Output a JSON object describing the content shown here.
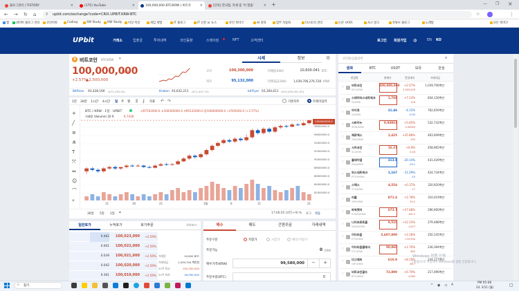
{
  "browser": {
    "tabs": [
      {
        "label": "블로그관리 | TISTORY",
        "color": "#ea4335"
      },
      {
        "label": "(175) YouTube",
        "color": "#ff0000"
      },
      {
        "label": "100,000,000 BTC/KRW | 비트코",
        "color": "#093687"
      },
      {
        "label": "[단독] 한국형, 유세 중 '이 말을'",
        "color": "#ea4335"
      }
    ],
    "url": "upbit.com/exchange?code=CRIX.UPBIT.KRW-BTC",
    "bookmarks": [
      "앱",
      "네이버 블로그 관리",
      "코인이야",
      "Coding",
      "SW Study",
      "HW Study",
      "이것 저것",
      "게임 개발",
      "IT 블로그",
      "IT 신문 or 뉴스",
      "유민 북마크",
      "AI 강좌",
      "업무 자동화",
      "티스토리 관리",
      "논문 사이트",
      "사고 알고",
      "유튜브 블로그",
      "노래방",
      "모든 북마크"
    ]
  },
  "upbit": {
    "logo": "UPbit",
    "nav": [
      "거래소",
      "입출금",
      "투자내역",
      "코인동향",
      "스테이킹",
      "NFT",
      "고객센터"
    ],
    "login": "로그인",
    "signup": "회원가입",
    "lang": [
      "EN",
      "KO"
    ],
    "coin": {
      "name": "비트코인",
      "pair": "BTC/KRW",
      "price": "100,000,000",
      "unit": "KRW",
      "change_pct": "+2.57%",
      "change_amt": "▲2,500,000",
      "tabs": [
        "시세",
        "정보"
      ],
      "stats": {
        "high_label": "고가",
        "high": "100,300,000",
        "low_label": "저가",
        "low": "95,132,000",
        "vol_label": "거래량(24H)",
        "vol": "10,600.041",
        "vol_unit": "BTC",
        "amt_label": "거래대금(24H)",
        "amt": "1,039,706,276,728",
        "amt_unit": "KRW"
      },
      "refs": [
        {
          "ex": "Bitfinex",
          "val": "93,428,166",
          "sub": "($71,292.00)"
        },
        {
          "ex": "Kraken",
          "val": "93,632,211",
          "sub": "($71,447.70)"
        },
        {
          "ex": "bitFlyer",
          "val": "93,304,611",
          "sub": "(¥10,455,001.00)"
        }
      ]
    },
    "chart": {
      "intervals": [
        "1분",
        "30분",
        "1시간",
        "4시간",
        "일",
        "주",
        "월"
      ],
      "indicator": "지표",
      "modes": [
        "기본차트",
        "트레이딩뷰"
      ],
      "title": "BTC / KRW · 1일 · UPBIT",
      "ohlc": "시97501000.0 고100300000.0 저95132000.0 종100000000.0 +2505000.0 (+2.57%)",
      "volume_label": "거래량 (Volume) 20 9",
      "volume_val": "6.743K",
      "yaxis": [
        "100000000.0",
        "98000000.0",
        "96000000.0",
        "94000000.0",
        "92000000.0",
        "90000000.0",
        "88000000.0",
        "86000000.0",
        "84000000.0",
        "82000000.0",
        "80000000.0"
      ],
      "xaxis": [
        "11",
        "16",
        "21",
        "3월",
        "6",
        "11",
        "21"
      ],
      "ranges": [
        "30일",
        "5일",
        "1일"
      ],
      "time": "17:06:05 (UTC+9)",
      "scale_opts": [
        "%",
        "로그",
        "자동"
      ],
      "current_price_tag": "100000000.0",
      "candles": [
        {
          "o": 64,
          "c": 66,
          "h": 67,
          "l": 62
        },
        {
          "o": 66,
          "c": 65,
          "h": 67,
          "l": 64
        },
        {
          "o": 65,
          "c": 64,
          "h": 66,
          "l": 63
        },
        {
          "o": 64,
          "c": 66,
          "h": 67,
          "l": 63
        },
        {
          "o": 66,
          "c": 67,
          "h": 68,
          "l": 65
        },
        {
          "o": 67,
          "c": 66,
          "h": 68,
          "l": 65
        },
        {
          "o": 66,
          "c": 67,
          "h": 67,
          "l": 65
        },
        {
          "o": 67,
          "c": 68,
          "h": 69,
          "l": 66
        },
        {
          "o": 68,
          "c": 67.5,
          "h": 69,
          "l": 67
        },
        {
          "o": 67.5,
          "c": 68,
          "h": 69,
          "l": 67
        },
        {
          "o": 68,
          "c": 67,
          "h": 68.5,
          "l": 66.5
        },
        {
          "o": 67,
          "c": 66.5,
          "h": 68,
          "l": 66
        },
        {
          "o": 66.5,
          "c": 68,
          "h": 69,
          "l": 66
        },
        {
          "o": 68,
          "c": 69,
          "h": 70,
          "l": 67.5
        },
        {
          "o": 69,
          "c": 68.5,
          "h": 70,
          "l": 68
        },
        {
          "o": 68.5,
          "c": 69,
          "h": 70,
          "l": 68
        },
        {
          "o": 69,
          "c": 71,
          "h": 72,
          "l": 68.5
        },
        {
          "o": 71,
          "c": 73,
          "h": 74,
          "l": 70.5
        },
        {
          "o": 73,
          "c": 75,
          "h": 76,
          "l": 72
        },
        {
          "o": 75,
          "c": 74,
          "h": 76,
          "l": 73
        },
        {
          "o": 74,
          "c": 76,
          "h": 77,
          "l": 73
        },
        {
          "o": 76,
          "c": 79,
          "h": 80,
          "l": 75
        },
        {
          "o": 79,
          "c": 82,
          "h": 83,
          "l": 78
        },
        {
          "o": 82,
          "c": 84,
          "h": 85,
          "l": 81
        },
        {
          "o": 84,
          "c": 86,
          "h": 87,
          "l": 83
        },
        {
          "o": 86,
          "c": 85,
          "h": 87,
          "l": 84
        },
        {
          "o": 85,
          "c": 87,
          "h": 88,
          "l": 84
        },
        {
          "o": 87,
          "c": 86,
          "h": 88,
          "l": 85
        },
        {
          "o": 86,
          "c": 88,
          "h": 90,
          "l": 85
        },
        {
          "o": 88,
          "c": 93,
          "h": 94,
          "l": 87
        },
        {
          "o": 93,
          "c": 91,
          "h": 94,
          "l": 90
        },
        {
          "o": 91,
          "c": 94,
          "h": 95,
          "l": 90
        },
        {
          "o": 94,
          "c": 92,
          "h": 95,
          "l": 91
        },
        {
          "o": 92,
          "c": 95,
          "h": 96,
          "l": 91
        },
        {
          "o": 95,
          "c": 96,
          "h": 97,
          "l": 94
        },
        {
          "o": 96,
          "c": 95.5,
          "h": 97,
          "l": 94.5
        },
        {
          "o": 95.5,
          "c": 97,
          "h": 98,
          "l": 95
        },
        {
          "o": 97,
          "c": 96.5,
          "h": 98,
          "l": 96
        },
        {
          "o": 96.5,
          "c": 98,
          "h": 99,
          "l": 96
        },
        {
          "o": 98,
          "c": 100,
          "h": 100.3,
          "l": 97
        }
      ],
      "volumes": [
        2,
        3,
        2,
        4,
        3,
        2,
        3,
        4,
        3,
        2,
        3,
        2,
        3,
        4,
        3,
        5,
        6,
        4,
        5,
        4,
        6,
        7,
        9,
        8,
        6,
        5,
        7,
        6,
        8,
        10,
        8,
        6,
        7,
        5,
        4,
        5,
        6,
        7,
        4,
        3
      ]
    },
    "orderbook": {
      "tabs": [
        "일반호가",
        "누적호가",
        "호가주문"
      ],
      "view": "모아보기",
      "rows": [
        {
          "q": "0.462",
          "p": "100,023,000",
          "c": "+2.59%"
        },
        {
          "q": "0.001",
          "p": "100,022,000",
          "c": "+2.59%"
        },
        {
          "q": "0.039",
          "p": "100,021,000",
          "c": "+2.59%"
        },
        {
          "q": "0.042",
          "p": "100,020,000",
          "c": "+2.59%"
        },
        {
          "q": "0.361",
          "p": "100,019,000",
          "c": "+2.59%"
        }
      ],
      "side_stats": [
        {
          "k": "거래량",
          "v": "10,600 BTC"
        },
        {
          "k": "거래대금",
          "v": "1,039,704 백만원"
        },
        {
          "k": "52주 최고",
          "v": "100,300,000"
        },
        {
          "k": "52주 최저",
          "v": "26,090,000"
        }
      ]
    },
    "order": {
      "tabs": [
        "매수",
        "매도",
        "간편주문",
        "거래내역"
      ],
      "type_label": "주문구분",
      "types": [
        "지정가",
        "시장가",
        "예약-지정가"
      ],
      "avail_label": "주문가능",
      "avail_value": "0",
      "avail_unit": "KRW",
      "price_label": "매수가격(KRW)",
      "price_value": "99,580,000",
      "qty_label": "주문수량(BTC)",
      "qty_value": "0"
    },
    "market": {
      "search_placeholder": "코인명/심볼검색",
      "tabs": [
        "원화",
        "BTC",
        "USDT",
        "보유",
        "관심"
      ],
      "headers": [
        "한글명",
        "현재가",
        "전일대비",
        "거래대금"
      ],
      "rows": [
        {
          "name": "비트코인",
          "ticker": "BTC/KRW",
          "price": "100,000,000",
          "chg": "+2.57%",
          "chg2": "2,505,000",
          "vol": "1,039,706백만",
          "dir": "up",
          "box": true
        },
        {
          "name": "스테이터스네트워크",
          "ticker": "IQ/KRW",
          "price": "1,768",
          "chg": "+7.13%",
          "chg2": "118",
          "vol": "834,130백만",
          "dir": "up",
          "box": true
        },
        {
          "name": "아이큐",
          "ticker": "IQ/KRW",
          "price": "21.46",
          "chg": "-4.15%",
          "chg2": "-0.93",
          "vol": "762,659백만",
          "dir": "down",
          "box": false
        },
        {
          "name": "시바이누",
          "ticker": "SHIB/KRW",
          "price": "0.04923",
          "chg": "+5.65%",
          "chg2": "0.00263",
          "vol": "532,732백만",
          "dir": "up",
          "box": true
        },
        {
          "name": "제로엑스",
          "ticker": "ZRX/KRW",
          "price": "1,425",
          "chg": "+25.88%",
          "chg2": "293",
          "vol": "463,949백만",
          "dir": "up",
          "box": false
        },
        {
          "name": "시아코인",
          "ticker": "SC/KRW",
          "price": "16.37",
          "chg": "+0.9%",
          "chg2": "0.16",
          "vol": "458,965백만",
          "dir": "up",
          "box": true
        },
        {
          "name": "플레이댑",
          "ticker": "PDA/KRW",
          "price": "313.6",
          "chg": "-20.14%",
          "chg2": "-79.1",
          "vol": "431,439백만",
          "dir": "down",
          "box": true
        },
        {
          "name": "피스네트워크",
          "ticker": "PYTH/KRW",
          "price": "1,167",
          "chg": "-11.29%",
          "chg2": "-15",
          "vol": "424,734백만",
          "dir": "down",
          "box": false
        },
        {
          "name": "스택스",
          "ticker": "STX/KRW",
          "price": "4,554",
          "chg": "+0.37%",
          "chg2": "17",
          "vol": "320,920백만",
          "dir": "up",
          "box": false
        },
        {
          "name": "리플",
          "ticker": "XRP/KRW",
          "price": "871.4",
          "chg": "+1.78%",
          "chg2": "15.2",
          "vol": "310,419백만",
          "dir": "up",
          "box": false
        },
        {
          "name": "파워렛저",
          "ticker": "POWR/KRW",
          "price": "673.7",
          "chg": "+17.68%",
          "chg2": "102.2",
          "vol": "296,900백만",
          "dir": "up",
          "box": true
        },
        {
          "name": "니어프로토콜",
          "ticker": "NEAR/KRW",
          "price": "9,510",
          "chg": "+12.15%",
          "chg2": "1,027",
          "vol": "279,488백만",
          "dir": "up",
          "box": true
        },
        {
          "name": "이더리움",
          "ticker": "ETH/KRW",
          "price": "5,607,000",
          "chg": "+2.18%",
          "chg2": "119,500",
          "vol": "250,145백만",
          "dir": "up",
          "box": false
        },
        {
          "name": "이더리움클래식",
          "ticker": "ETC/KRW",
          "price": "50,060",
          "chg": "+1.70%",
          "chg2": "840",
          "vol": "236,394백만",
          "dir": "up",
          "box": true
        },
        {
          "name": "더그래프",
          "ticker": "GRT/KRW",
          "price": "616.9",
          "chg": "+8.19%",
          "chg2": "46.7",
          "vol": "224,177백만",
          "dir": "up",
          "box": false
        },
        {
          "name": "비트코인골드",
          "ticker": "BTG/KRW",
          "price": "72,890",
          "chg": "+6.70%",
          "chg2": "4,580",
          "vol": "217,096백만",
          "dir": "up",
          "box": false
        }
      ]
    }
  },
  "windows_overlay": {
    "line1": "Windows 정품 인증",
    "line2": "[설정]으로 이동하여 Windows를 정품 인증합니다."
  },
  "taskbar": {
    "search": "찾기",
    "time": "PM 05:08",
    "date": "24. 3/11 (월)"
  }
}
